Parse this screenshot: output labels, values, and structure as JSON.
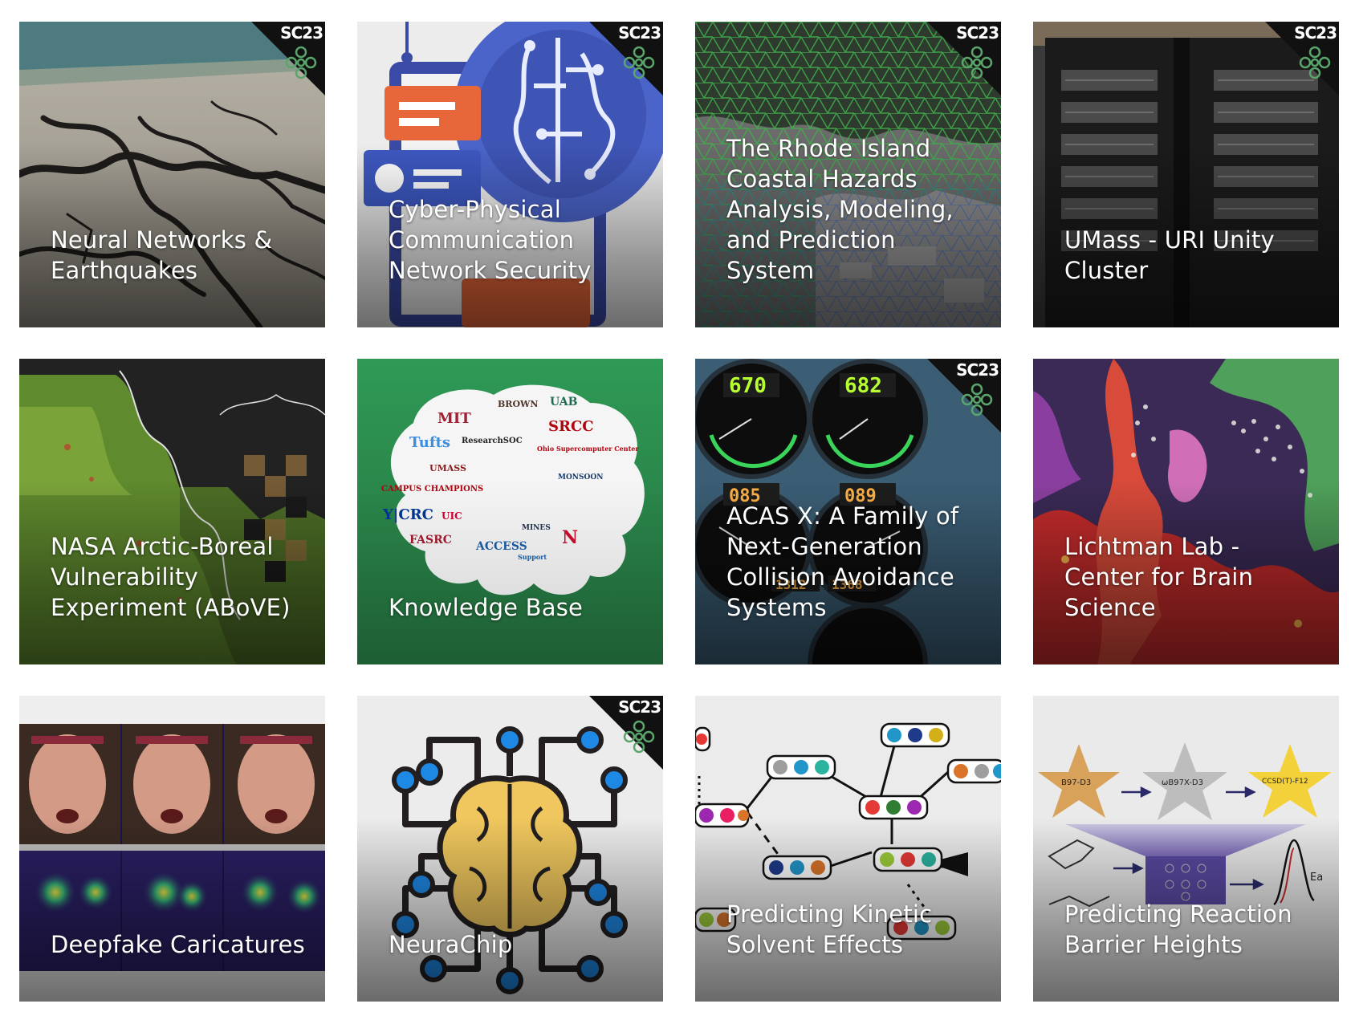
{
  "badge_label": "SC23",
  "tiles": [
    {
      "title": "Neural Networks & Earthquakes",
      "badge": true
    },
    {
      "title": "Cyber-Physical Communication Network Security",
      "badge": true
    },
    {
      "title": "The Rhode Island Coastal Hazards Analysis, Modeling, and Prediction System",
      "badge": true
    },
    {
      "title": "UMass - URI Unity Cluster",
      "badge": true
    },
    {
      "title": "NASA Arctic-Boreal Vulnerability Experiment (ABoVE)",
      "badge": false
    },
    {
      "title": "Knowledge Base",
      "badge": false
    },
    {
      "title": "ACAS X: A Family of Next-Generation Collision Avoidance Systems",
      "badge": true
    },
    {
      "title": "Lichtman Lab - Center for Brain Science",
      "badge": false
    },
    {
      "title": "Deepfake Caricatures",
      "badge": false
    },
    {
      "title": "NeuraChip",
      "badge": true
    },
    {
      "title": "Predicting Kinetic Solvent Effects",
      "badge": false
    },
    {
      "title": "Predicting Reaction Barrier Heights",
      "badge": false
    }
  ],
  "knowledge_base_logos": [
    "MIT",
    "BROWN",
    "UAB",
    "SRCC",
    "Tufts",
    "ResearchSOC",
    "Ohio Supercomputer Center",
    "UMASS",
    "CAMPUS CHAMPIONS",
    "Y|CRC",
    "UIC",
    "MINES",
    "FASRC",
    "ACCESS",
    "Support",
    "MONSOON",
    "N"
  ],
  "acas_gauges": [
    "670",
    "682",
    "085",
    "089",
    "1312",
    "1368"
  ],
  "reaction_labels": [
    "B97-D3",
    "ωB97X-D3",
    "CCSD(T)-F12",
    "Ea"
  ]
}
